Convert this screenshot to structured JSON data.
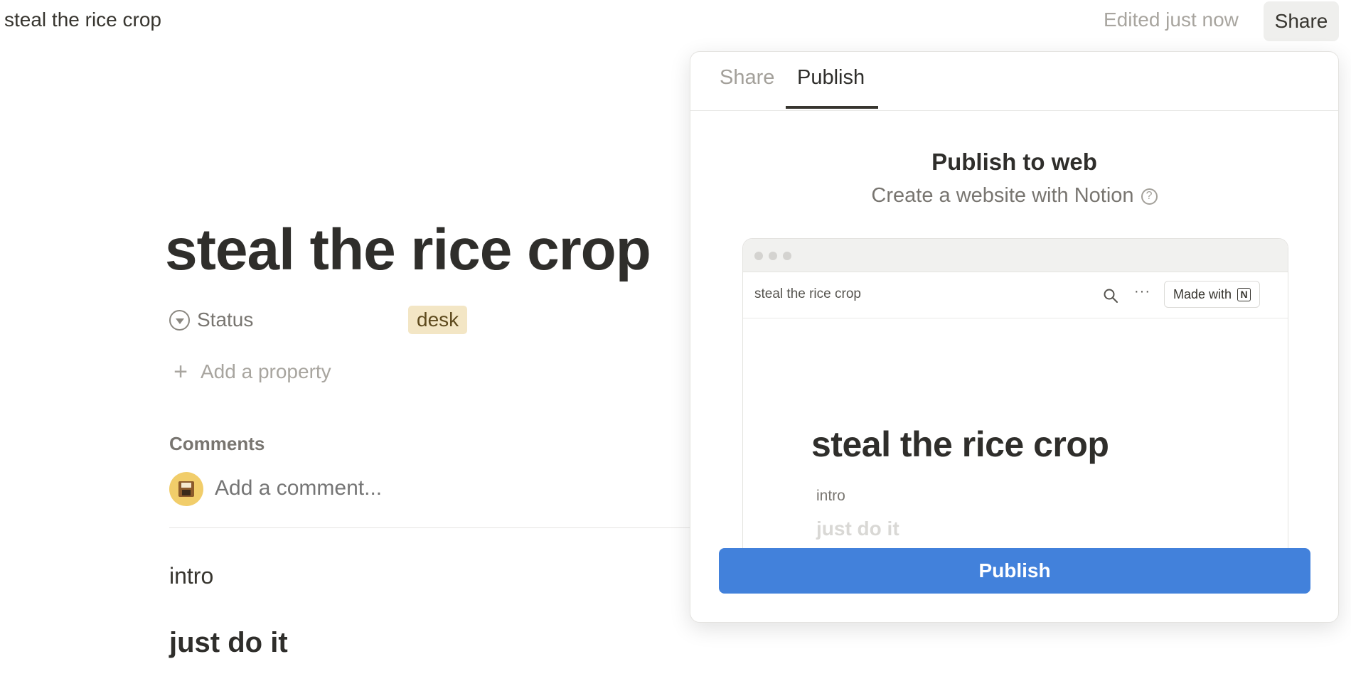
{
  "topbar": {
    "title": "steal the rice crop",
    "edited": "Edited just now",
    "share_label": "Share"
  },
  "page": {
    "title": "steal the rice crop",
    "properties": [
      {
        "label": "Status",
        "value": "desk",
        "icon": "status-icon"
      }
    ],
    "add_property": "Add a property",
    "comments_heading": "Comments",
    "comment_placeholder": "Add a comment...",
    "blocks": {
      "intro": "intro",
      "heading": "just do it"
    }
  },
  "panel": {
    "tabs": [
      {
        "label": "Share",
        "active": false
      },
      {
        "label": "Publish",
        "active": true
      }
    ],
    "title": "Publish to web",
    "subtitle": "Create a website with Notion",
    "preview": {
      "nav_title": "steal the rice crop",
      "more": "···",
      "made_with": "Made with",
      "logo_letter": "N",
      "page_title": "steal the rice crop",
      "intro": "intro",
      "heading": "just do it"
    },
    "publish_label": "Publish"
  },
  "colors": {
    "accent": "#4281db",
    "tag_bg": "#f3e6c5",
    "avatar_bg": "#f1cd6a"
  }
}
